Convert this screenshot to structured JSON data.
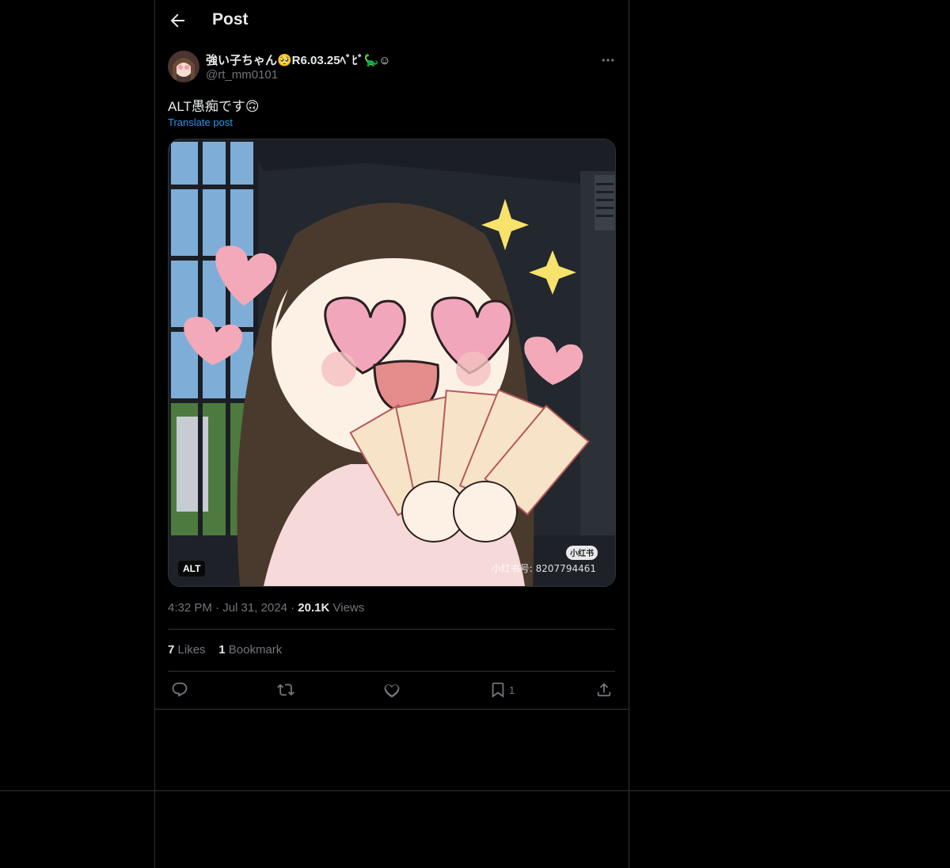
{
  "header": {
    "title": "Post",
    "back_icon": "arrow-left-icon"
  },
  "author": {
    "display_name": "強い子ちゃん🥺R6.03.25ﾍﾞﾋﾞ🦕☺",
    "handle": "@rt_mm0101"
  },
  "post": {
    "text": "ALT愚痴です🙃",
    "translate_label": "Translate post",
    "media_alt_badge": "ALT",
    "watermark_badge": "小红书",
    "watermark_id": "小红书号: 8207794461"
  },
  "meta": {
    "time": "4:32 PM",
    "date": "Jul 31, 2024",
    "views_count": "20.1K",
    "views_label": "Views",
    "dot": "·"
  },
  "stats": {
    "likes_count": "7",
    "likes_label": "Likes",
    "bookmarks_count": "1",
    "bookmarks_label": "Bookmark"
  },
  "actions": {
    "bookmark_count": "1",
    "icons": [
      "reply-icon",
      "repost-icon",
      "like-icon",
      "bookmark-icon",
      "share-icon"
    ]
  },
  "colors": {
    "link": "#1d9bf0",
    "muted": "#71767b",
    "border": "#2f3336",
    "text": "#e7e9ea"
  }
}
